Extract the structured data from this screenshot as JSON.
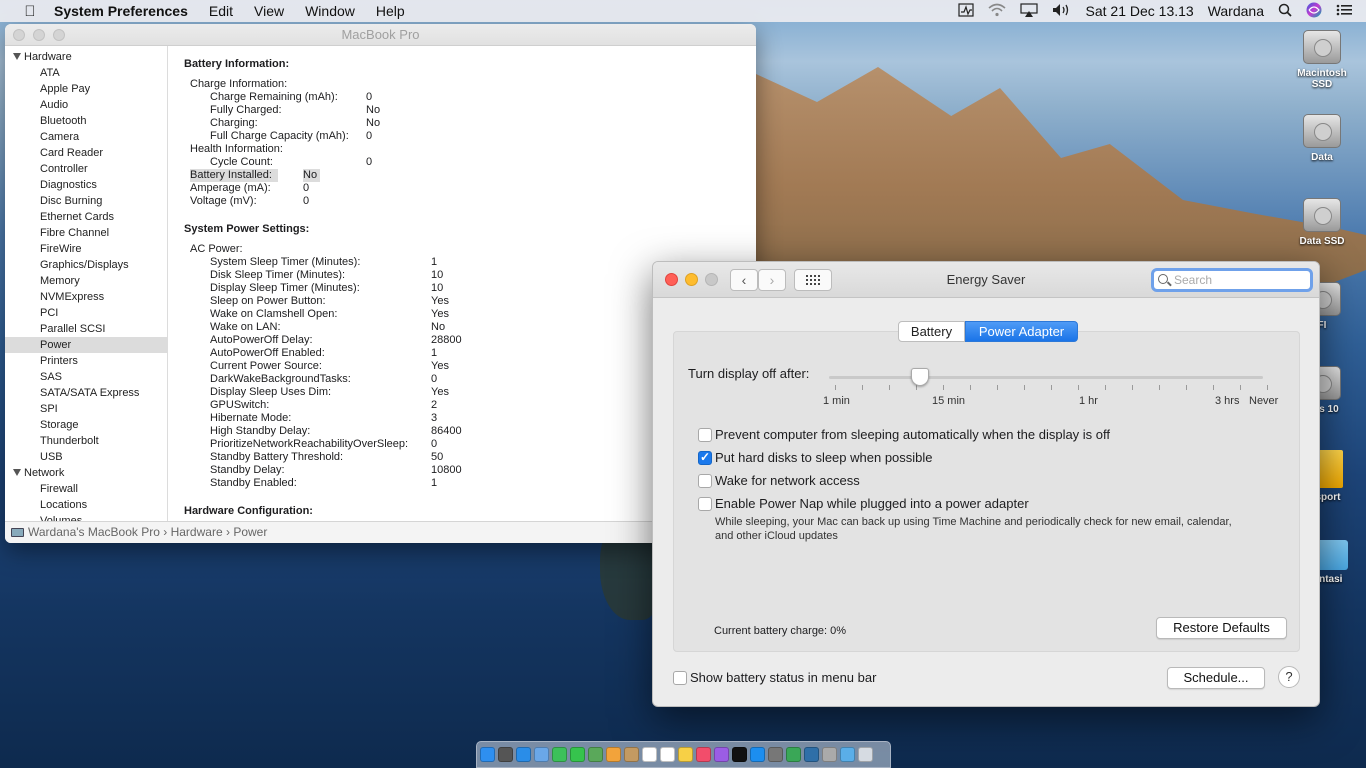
{
  "menubar": {
    "app": "System Preferences",
    "menus": [
      "Edit",
      "View",
      "Window",
      "Help"
    ],
    "clock": "Sat 21 Dec  13.13",
    "user": "Wardana"
  },
  "desktop_icons": [
    {
      "label": "Macintosh SSD"
    },
    {
      "label": "Data"
    },
    {
      "label": "Data SSD"
    },
    {
      "label": "FI"
    },
    {
      "label": "ows 10"
    },
    {
      "label": "sport"
    },
    {
      "label": "entasi"
    }
  ],
  "sysinfo": {
    "title": "MacBook Pro",
    "sidebar": [
      {
        "label": "Hardware",
        "group": true
      },
      {
        "label": "ATA"
      },
      {
        "label": "Apple Pay"
      },
      {
        "label": "Audio"
      },
      {
        "label": "Bluetooth"
      },
      {
        "label": "Camera"
      },
      {
        "label": "Card Reader"
      },
      {
        "label": "Controller"
      },
      {
        "label": "Diagnostics"
      },
      {
        "label": "Disc Burning"
      },
      {
        "label": "Ethernet Cards"
      },
      {
        "label": "Fibre Channel"
      },
      {
        "label": "FireWire"
      },
      {
        "label": "Graphics/Displays"
      },
      {
        "label": "Memory"
      },
      {
        "label": "NVMExpress"
      },
      {
        "label": "PCI"
      },
      {
        "label": "Parallel SCSI"
      },
      {
        "label": "Power",
        "selected": true
      },
      {
        "label": "Printers"
      },
      {
        "label": "SAS"
      },
      {
        "label": "SATA/SATA Express"
      },
      {
        "label": "SPI"
      },
      {
        "label": "Storage"
      },
      {
        "label": "Thunderbolt"
      },
      {
        "label": "USB"
      },
      {
        "label": "Network",
        "group": true
      },
      {
        "label": "Firewall"
      },
      {
        "label": "Locations"
      },
      {
        "label": "Volumes"
      }
    ],
    "battery_heading": "Battery Information:",
    "battery_rows": [
      {
        "k": "Charge Information:",
        "v": "",
        "indent": 1
      },
      {
        "k": "Charge Remaining (mAh):",
        "v": "0",
        "indent": 2
      },
      {
        "k": "Fully Charged:",
        "v": "No",
        "indent": 2
      },
      {
        "k": "Charging:",
        "v": "No",
        "indent": 2
      },
      {
        "k": "Full Charge Capacity (mAh):",
        "v": "0",
        "indent": 2
      },
      {
        "k": "Health Information:",
        "v": "",
        "indent": 1
      },
      {
        "k": "Cycle Count:",
        "v": "0",
        "indent": 2
      },
      {
        "k": "Battery Installed:",
        "v": "No",
        "indent": 1,
        "highlight": true
      },
      {
        "k": "Amperage (mA):",
        "v": "0",
        "indent": 1
      },
      {
        "k": "Voltage (mV):",
        "v": "0",
        "indent": 1
      }
    ],
    "power_heading": "System Power Settings:",
    "power_rows": [
      {
        "k": "AC Power:",
        "v": "",
        "indent": 1
      },
      {
        "k": "System Sleep Timer (Minutes):",
        "v": "1",
        "indent": 2
      },
      {
        "k": "Disk Sleep Timer (Minutes):",
        "v": "10",
        "indent": 2
      },
      {
        "k": "Display Sleep Timer (Minutes):",
        "v": "10",
        "indent": 2
      },
      {
        "k": "Sleep on Power Button:",
        "v": "Yes",
        "indent": 2
      },
      {
        "k": "Wake on Clamshell Open:",
        "v": "Yes",
        "indent": 2
      },
      {
        "k": "Wake on LAN:",
        "v": "No",
        "indent": 2
      },
      {
        "k": "AutoPowerOff Delay:",
        "v": "28800",
        "indent": 2
      },
      {
        "k": "AutoPowerOff Enabled:",
        "v": "1",
        "indent": 2
      },
      {
        "k": "Current Power Source:",
        "v": "Yes",
        "indent": 2
      },
      {
        "k": "DarkWakeBackgroundTasks:",
        "v": "0",
        "indent": 2
      },
      {
        "k": "Display Sleep Uses Dim:",
        "v": "Yes",
        "indent": 2
      },
      {
        "k": "GPUSwitch:",
        "v": "2",
        "indent": 2
      },
      {
        "k": "Hibernate Mode:",
        "v": "3",
        "indent": 2
      },
      {
        "k": "High Standby Delay:",
        "v": "86400",
        "indent": 2
      },
      {
        "k": "PrioritizeNetworkReachabilityOverSleep:",
        "v": "0",
        "indent": 2
      },
      {
        "k": "Standby Battery Threshold:",
        "v": "50",
        "indent": 2
      },
      {
        "k": "Standby Delay:",
        "v": "10800",
        "indent": 2
      },
      {
        "k": "Standby Enabled:",
        "v": "1",
        "indent": 2
      }
    ],
    "hardware_heading": "Hardware Configuration:",
    "path": {
      "computer": "Wardana's MacBook Pro",
      "sep1": "›",
      "section": "Hardware",
      "sep2": "›",
      "item": "Power"
    }
  },
  "energy": {
    "title": "Energy Saver",
    "search_placeholder": "Search",
    "tab_battery": "Battery",
    "tab_adapter": "Power Adapter",
    "slider_label": "Turn display off after:",
    "slider_ticks": [
      "1 min",
      "15 min",
      "1 hr",
      "3 hrs",
      "Never"
    ],
    "slider_value": "15 min",
    "prevent_sleep": "Prevent computer from sleeping automatically when the display is off",
    "prevent_sleep_checked": false,
    "hdd_sleep": "Put hard disks to sleep when possible",
    "hdd_sleep_checked": true,
    "wake_network": "Wake for network access",
    "wake_network_checked": false,
    "power_nap": "Enable Power Nap while plugged into a power adapter",
    "power_nap_checked": false,
    "power_nap_desc": "While sleeping, your Mac can back up using Time Machine and periodically check for new email, calendar, and other iCloud updates",
    "battery_charge": "Current battery charge: 0%",
    "restore_defaults": "Restore Defaults",
    "show_battery_status": "Show battery status in menu bar",
    "show_battery_checked": false,
    "schedule": "Schedule...",
    "help": "?"
  },
  "colors": {
    "accent": "#1b79ec",
    "close": "#ff5f57",
    "minimize": "#febc2e",
    "zoom": "#c8c8c8"
  },
  "dock_icons": [
    "finder-icon",
    "launchpad-icon",
    "safari-icon",
    "mail-icon",
    "facetime-icon",
    "messages-icon",
    "maps-icon",
    "photos-icon",
    "contacts-icon",
    "calendar-icon",
    "reminders-icon",
    "notes-icon",
    "music-icon",
    "podcasts-icon",
    "tv-icon",
    "app-store-icon",
    "system-preferences-icon",
    "chrome-icon",
    "activity-monitor-icon",
    "stack-icon",
    "folder-icon",
    "trash-icon"
  ]
}
